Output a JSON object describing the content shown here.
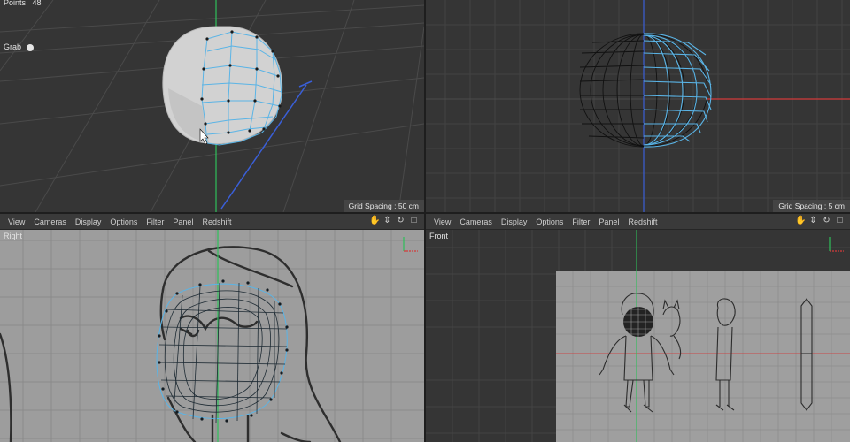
{
  "top_left": {
    "points_label": "Points",
    "points_value": "48",
    "tool_label": "Grab",
    "grid_spacing": "Grid Spacing : 50 cm"
  },
  "top_right": {
    "grid_spacing": "Grid Spacing : 5 cm"
  },
  "bottom_left": {
    "menu": [
      "View",
      "Cameras",
      "Display",
      "Options",
      "Filter",
      "Panel",
      "Redshift"
    ],
    "view_name": "Right"
  },
  "bottom_right": {
    "menu": [
      "View",
      "Cameras",
      "Display",
      "Options",
      "Filter",
      "Panel",
      "Redshift"
    ],
    "view_name": "Front"
  },
  "icons": [
    "hand-pan-icon",
    "move-arrows-icon",
    "rotate-icon",
    "maximize-icon"
  ],
  "colors": {
    "viewport_bg": "#343434",
    "ortho_bg": "#9c9c9c",
    "wire": "#5ab4e6",
    "axis_green": "#2fbf5a",
    "axis_red": "#d23b3b",
    "axis_blue": "#3a5fd8"
  }
}
